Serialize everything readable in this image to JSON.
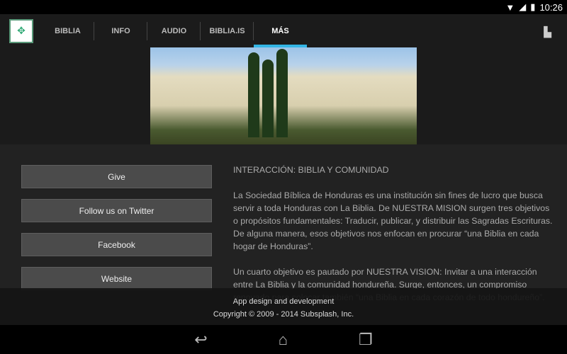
{
  "status": {
    "time": "10:26"
  },
  "nav": {
    "tabs": [
      {
        "label": "BIBLIA"
      },
      {
        "label": "INFO"
      },
      {
        "label": "AUDIO"
      },
      {
        "label": "BIBLIA.IS"
      },
      {
        "label": "MÁS",
        "active": true
      }
    ],
    "accent": "#33b5e5"
  },
  "buttons": [
    {
      "label": "Give"
    },
    {
      "label": "Follow us on Twitter"
    },
    {
      "label": "Facebook"
    },
    {
      "label": "Website"
    }
  ],
  "content": {
    "heading": "INTERACCIÓN: BIBLIA Y COMUNIDAD",
    "p1": "La Sociedad Bíblica de Honduras es una institución sin fines de lucro que busca servir a toda Honduras con La Biblia.  De NUESTRA MISION surgen tres objetivos o propósitos fundamentales: Traducir, publicar, y distribuir las Sagradas Escrituras. De alguna manera, esos objetivos nos enfocan en procurar “una Biblia en cada hogar de Honduras”.",
    "p2": "Un cuarto objetivo es pautado por NUESTRA VISION:  Invitar a una interacción entre La Biblia y la comunidad hondureña.  Surge, entonces, un compromiso renovado para colocar también “una Biblia en cada corazón de todo hondureño”."
  },
  "footer": {
    "line1": "App design and development",
    "line2": "Copyright © 2009 - 2014 Subsplash, Inc."
  }
}
